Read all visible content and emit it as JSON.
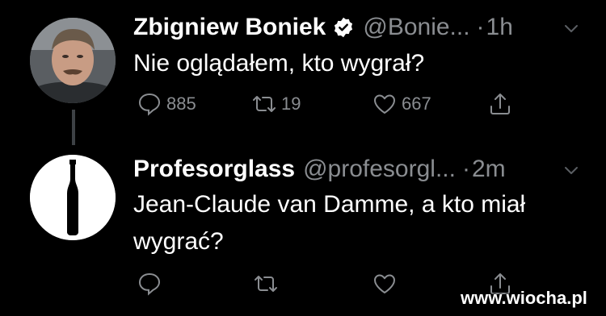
{
  "tweets": [
    {
      "name": "Zbigniew Boniek",
      "verified": true,
      "handle": "@Bonie...",
      "separator": "·",
      "time": "1h",
      "text": "Nie oglądałem, kto wygrał?",
      "actions": {
        "replies": "885",
        "retweets": "19",
        "likes": "667"
      }
    },
    {
      "name": "Profesorglass",
      "verified": false,
      "handle": "@profesorgl...",
      "separator": "·",
      "time": "2m",
      "text": "Jean-Claude van Damme, a kto miał wygrać?",
      "actions": {
        "replies": "",
        "retweets": "",
        "likes": ""
      }
    }
  ],
  "icons": [
    "verified-badge-icon",
    "chevron-down-icon",
    "reply-icon",
    "retweet-icon",
    "like-icon",
    "share-icon"
  ],
  "colors": {
    "background": "#000000",
    "text": "#ffffff",
    "secondary": "#8a8d91",
    "thread_line": "#3d4145"
  },
  "watermark": "www.wiocha.pl"
}
